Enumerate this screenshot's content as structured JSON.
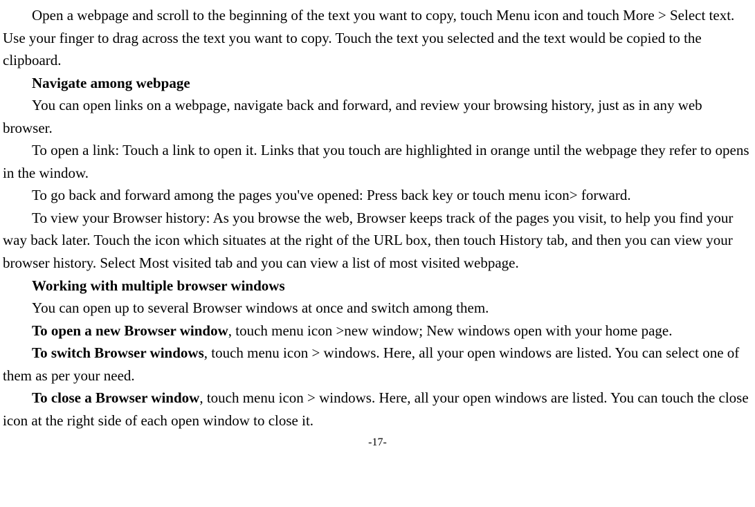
{
  "p1": "Open a webpage and scroll to the beginning of the text you want to copy, touch Menu icon and touch More > Select text. Use your finger to drag across the text you want to copy. Touch the text you selected and the text would be copied to the clipboard.",
  "h1": "Navigate among webpage",
  "p2": "You can open links on a webpage, navigate back and forward, and review your browsing history, just as in any web browser.",
  "p3": "To open a link: Touch a link to open it. Links that you touch are highlighted in orange until the webpage they refer to opens in the window.",
  "p4": "To go back and forward among the pages you've opened: Press back key or touch menu icon> forward.",
  "p5": "To view your Browser history: As you browse the web, Browser keeps track of the pages you visit, to help you find your way back later. Touch the icon which situates at the right of the URL box, then touch History tab, and then you can view your browser history. Select Most visited tab and you can view a list of most visited webpage.",
  "h2": "Working with multiple browser windows",
  "p6": "You can open up to several Browser windows at once and switch among them.",
  "p7_bold": "To open a new Browser window",
  "p7_rest": ", touch menu icon >new window; New windows open with your home page.",
  "p8_bold": "To switch Browser windows",
  "p8_rest": ", touch menu icon > windows. Here, all your open windows are listed. You can select one of them as per your need.",
  "p9_bold": "To close a Browser window",
  "p9_rest": ", touch menu icon > windows. Here, all your open windows are listed. You can touch the close icon at the right side of each open window to close it.",
  "page_number": "-17-"
}
